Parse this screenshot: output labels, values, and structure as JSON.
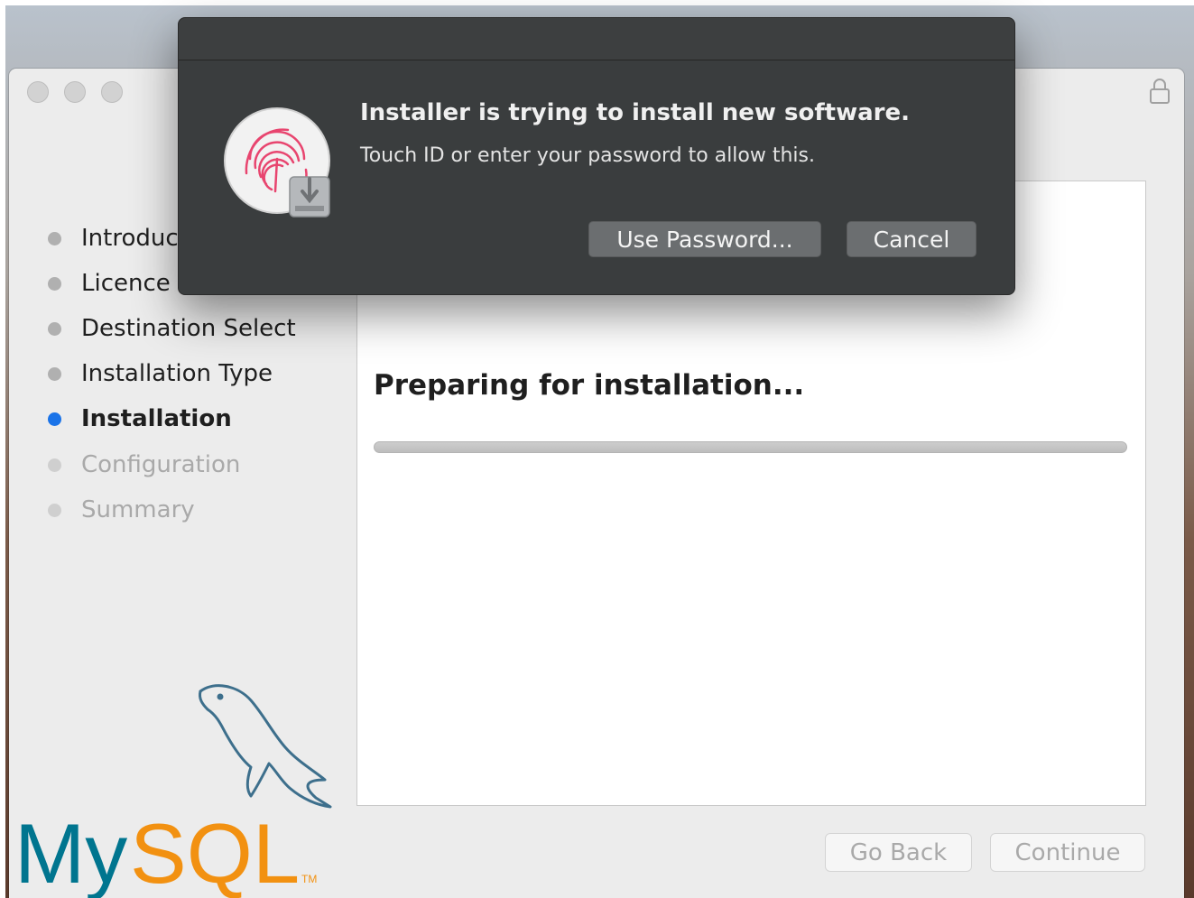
{
  "sidebar": {
    "steps": [
      {
        "label": "Introduc",
        "state": "done"
      },
      {
        "label": "Licence",
        "state": "done"
      },
      {
        "label": "Destination Select",
        "state": "done"
      },
      {
        "label": "Installation Type",
        "state": "done"
      },
      {
        "label": "Installation",
        "state": "active"
      },
      {
        "label": "Configuration",
        "state": "future"
      },
      {
        "label": "Summary",
        "state": "future"
      }
    ]
  },
  "main": {
    "status": "Preparing for installation...",
    "progress": 0.0
  },
  "footer": {
    "go_back": "Go Back",
    "continue": "Continue"
  },
  "auth_dialog": {
    "title": "Installer is trying to install new software.",
    "message": "Touch ID or enter your password to allow this.",
    "use_password": "Use Password...",
    "cancel": "Cancel",
    "icon": "touch-id-installer-icon"
  },
  "logo": {
    "brand": "MySQL",
    "tm": "TM",
    "colors": {
      "my": "#00758f",
      "sql": "#f29111"
    }
  },
  "colors": {
    "active_dot": "#1a73e8",
    "dialog_bg": "#3a3d3e",
    "window_bg": "#ececec"
  }
}
